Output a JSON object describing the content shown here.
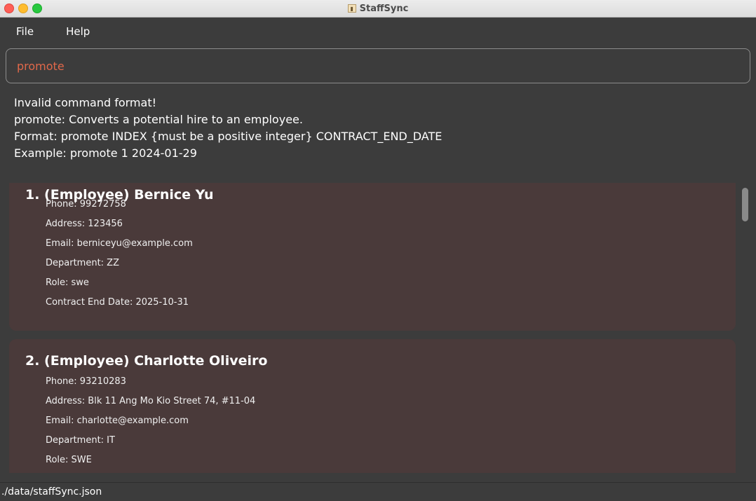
{
  "window": {
    "title": "StaffSync"
  },
  "menu": {
    "file": "File",
    "help": "Help"
  },
  "command": {
    "value": "promote"
  },
  "result": {
    "lines": [
      "Invalid command format!",
      "promote: Converts a potential hire to an employee.",
      "Format: promote INDEX {must be a positive integer} CONTRACT_END_DATE",
      "Example: promote 1 2024-01-29"
    ]
  },
  "persons": [
    {
      "header": "1. (Employee) Bernice Yu",
      "phone": "Phone: 99272758",
      "address": "Address: 123456",
      "email": "Email: berniceyu@example.com",
      "department": "Department: ZZ",
      "role": "Role: swe",
      "contract": "Contract End Date: 2025-10-31"
    },
    {
      "header": "2. (Employee) Charlotte Oliveiro",
      "phone": "Phone: 93210283",
      "address": "Address: Blk 11 Ang Mo Kio Street 74, #11-04",
      "email": "Email: charlotte@example.com",
      "department": "Department: IT",
      "role": "Role: SWE"
    }
  ],
  "status": {
    "path": "./data/staffSync.json"
  },
  "colors": {
    "background": "#3c3c3c",
    "card": "#4a3a3a",
    "command_text": "#e0684a"
  }
}
